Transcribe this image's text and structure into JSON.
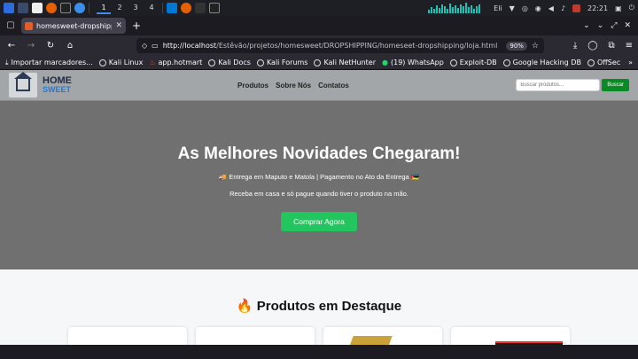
{
  "taskbar": {
    "workspaces": [
      "1",
      "2",
      "3",
      "4"
    ],
    "active_workspace": "1",
    "user": "Eli",
    "clock": "22:21"
  },
  "browser": {
    "tab_title": "homesweet-dropshipping",
    "url_host": "http://localhost",
    "url_path": "/Estêvão/projetos/homesweet/DROPSHIPPING/homeseet-dropshipping/loja.html",
    "zoom": "90%",
    "bookmarks": [
      {
        "label": "Importar marcadores..."
      },
      {
        "label": "Kali Linux"
      },
      {
        "label": "app.hotmart"
      },
      {
        "label": "Kali Docs"
      },
      {
        "label": "Kali Forums"
      },
      {
        "label": "Kali NetHunter"
      },
      {
        "label": "(19) WhatsApp"
      },
      {
        "label": "Exploit-DB"
      },
      {
        "label": "Google Hacking DB"
      },
      {
        "label": "OffSec"
      }
    ]
  },
  "site": {
    "logo_home": "HOME",
    "logo_sweet": "SWEET",
    "nav": [
      "Produtos",
      "Sobre Nós",
      "Contatos"
    ],
    "search_placeholder": "Buscar produtos...",
    "search_button": "Buscar",
    "hero_title": "As Melhores Novidades Chegaram!",
    "hero_line1": "🚚 Entrega em Maputo e Matola | Pagamento no Ato da Entrega 🇲🇿",
    "hero_line2": "Receba em casa e só pague quando tiver o produto na mão.",
    "hero_button": "Comprar Agora",
    "products_title": "🔥 Produtos em Destaque"
  },
  "colors": {
    "header_bg": "#a3a6a8",
    "hero_bg": "#707070",
    "accent_green": "#22c55e",
    "search_green": "#0a8a23",
    "logo_blue": "#1e7be0"
  }
}
